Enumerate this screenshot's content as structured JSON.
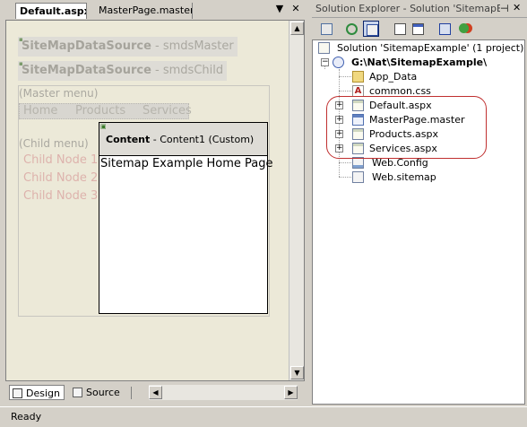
{
  "document_tabs": [
    {
      "label": "Default.aspx",
      "active": true
    },
    {
      "label": "MasterPage.master",
      "active": false
    }
  ],
  "design_surface": {
    "controls": [
      {
        "type": "SiteMapDataSource",
        "id": "smdsMaster",
        "label_bold": "SiteMapDataSource",
        "label_rest": " - smdsMaster"
      },
      {
        "type": "SiteMapDataSource",
        "id": "smdsChild",
        "label_bold": "SiteMapDataSource",
        "label_rest": " - smdsChild"
      }
    ],
    "master_menu_label": "(Master menu)",
    "master_menu_items": [
      "Home",
      "Products",
      "Services"
    ],
    "child_menu_label": "(Child menu)",
    "child_nodes": [
      "Child Node 1",
      "Child Node 2",
      "Child Node 3"
    ],
    "content": {
      "header_bold": "Content",
      "header_rest": " - Content1 (Custom)",
      "body_text": "Sitemap Example Home Page"
    }
  },
  "view_buttons": {
    "design": "Design",
    "source": "Source"
  },
  "status": "Ready",
  "solution_explorer": {
    "title": "Solution Explorer - Solution 'SitemapExample'",
    "toolbar_icons": [
      "properties-icon",
      "refresh-icon",
      "nest-related-icon",
      "view-code-icon",
      "view-designer-icon",
      "copy-website-icon",
      "aspnet-config-icon"
    ],
    "solution_label": "Solution 'SitemapExample' (1 project)",
    "project_label": "G:\\Nat\\SitemapExample\\",
    "items": [
      {
        "label": "App_Data",
        "icon": "folder-icon",
        "expandable": false
      },
      {
        "label": "common.css",
        "icon": "css-file-icon",
        "expandable": false
      },
      {
        "label": "Default.aspx",
        "icon": "aspx-page-icon",
        "expandable": true
      },
      {
        "label": "MasterPage.master",
        "icon": "master-page-icon",
        "expandable": true
      },
      {
        "label": "Products.aspx",
        "icon": "aspx-page-icon",
        "expandable": true
      },
      {
        "label": "Services.aspx",
        "icon": "aspx-page-icon",
        "expandable": true
      },
      {
        "label": "Web.Config",
        "icon": "config-file-icon",
        "expandable": false
      },
      {
        "label": "Web.sitemap",
        "icon": "sitemap-file-icon",
        "expandable": false
      }
    ]
  },
  "colors": {
    "chrome": "#d4d0c8",
    "design_background": "#ece9d8",
    "child_node_text": "#ddb2ac",
    "highlight_ellipse": "#c03030"
  }
}
